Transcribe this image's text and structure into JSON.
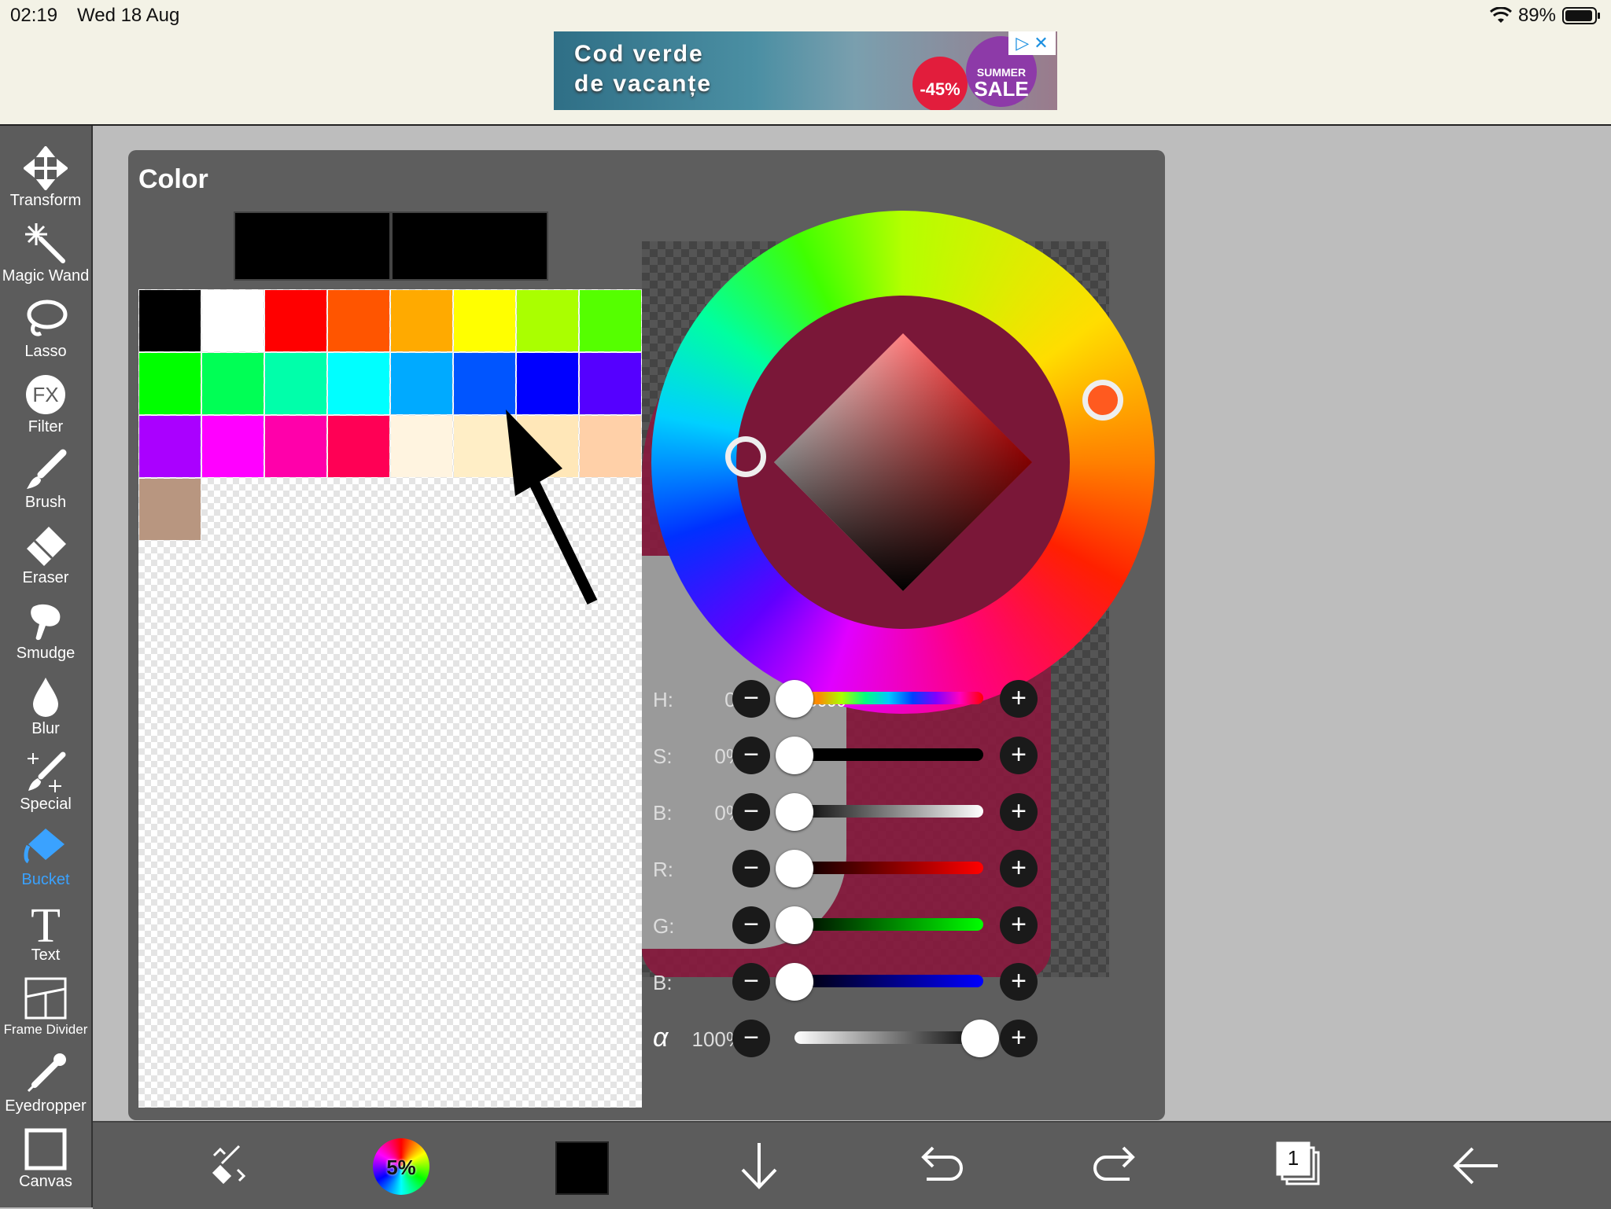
{
  "status": {
    "time": "02:19",
    "date": "Wed 18 Aug",
    "battery": "89%"
  },
  "ad": {
    "line1": "Cod verde",
    "line2": "de vacanțe",
    "discount": "-45%",
    "sale_top": "SUMMER",
    "sale": "SALE"
  },
  "tools": [
    {
      "name": "transform",
      "label": "Transform"
    },
    {
      "name": "magic-wand",
      "label": "Magic Wand"
    },
    {
      "name": "lasso",
      "label": "Lasso"
    },
    {
      "name": "filter",
      "label": "Filter"
    },
    {
      "name": "brush",
      "label": "Brush"
    },
    {
      "name": "eraser",
      "label": "Eraser"
    },
    {
      "name": "smudge",
      "label": "Smudge"
    },
    {
      "name": "blur",
      "label": "Blur"
    },
    {
      "name": "special",
      "label": "Special"
    },
    {
      "name": "bucket",
      "label": "Bucket"
    },
    {
      "name": "text",
      "label": "Text"
    },
    {
      "name": "frame-divider",
      "label": "Frame Divider"
    },
    {
      "name": "eyedropper",
      "label": "Eyedropper"
    },
    {
      "name": "canvas",
      "label": "Canvas"
    }
  ],
  "active_tool": "Bucket",
  "panel": {
    "title": "Color",
    "hex": "#000000",
    "palette": [
      "#000000",
      "#ffffff",
      "#ff0000",
      "#ff5500",
      "#ffaa00",
      "#ffff00",
      "#aaff00",
      "#55ff00",
      "#00ff00",
      "#00ff55",
      "#00ffaa",
      "#00ffff",
      "#00aaff",
      "#0055ff",
      "#0000ff",
      "#5500ff",
      "#aa00ff",
      "#ff00ff",
      "#ff00aa",
      "#ff0055",
      "#fff4e0",
      "#ffeec6",
      "#ffe7b8",
      "#ffd0a8",
      "#b89680"
    ],
    "sliders": [
      {
        "label": "H:",
        "value": "0°",
        "level": 0
      },
      {
        "label": "S:",
        "value": "0%",
        "level": 0
      },
      {
        "label": "B:",
        "value": "0%",
        "level": 0
      },
      {
        "label": "R:",
        "value": "0",
        "level": 0
      },
      {
        "label": "G:",
        "value": "0",
        "level": 0
      },
      {
        "label": "B:",
        "value": "0",
        "level": 0
      },
      {
        "label": "α",
        "value": "100%",
        "level": 1
      }
    ]
  },
  "bottom": {
    "brush_size": "5%",
    "layers": "1"
  }
}
